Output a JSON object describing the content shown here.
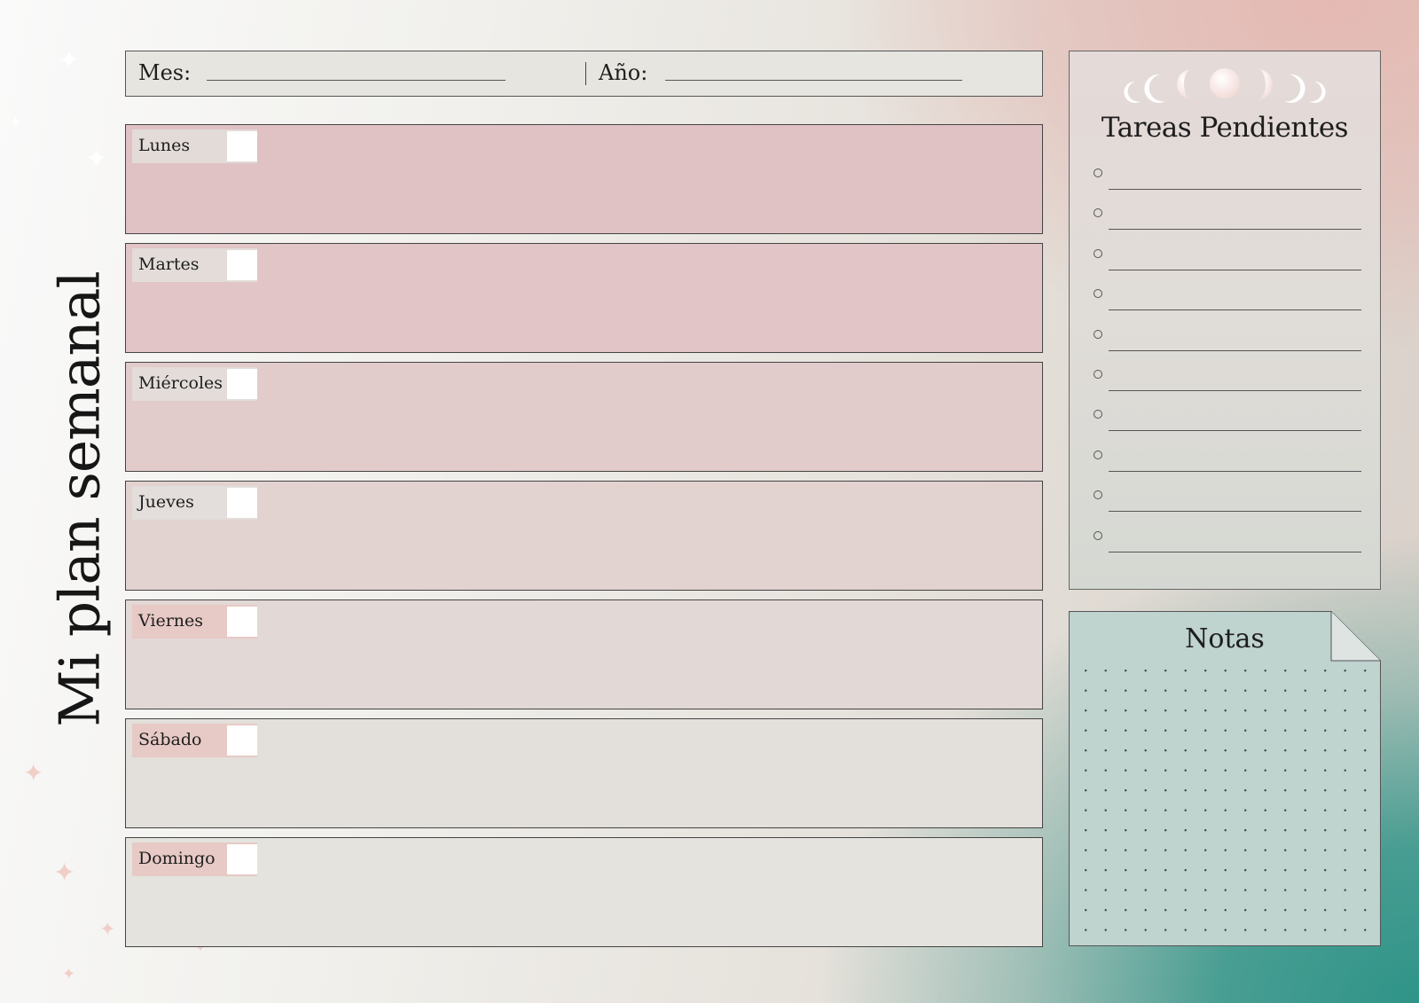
{
  "page": {
    "title": "Mi plan semanal"
  },
  "header": {
    "month_label": "Mes:",
    "year_label": "Año:"
  },
  "days": [
    {
      "label": "Lunes",
      "bg": "#e0c1c4",
      "tab": "#e3dbd8"
    },
    {
      "label": "Martes",
      "bg": "#e2c5c7",
      "tab": "#e3dcd9"
    },
    {
      "label": "Miércoles",
      "bg": "#e2cbcb",
      "tab": "#e3dcd9"
    },
    {
      "label": "Jueves",
      "bg": "#e2d2d0",
      "tab": "#e3dedb"
    },
    {
      "label": "Viernes",
      "bg": "#e2d8d6",
      "tab": "#e7c9c5"
    },
    {
      "label": "Sábado",
      "bg": "#e3dfdb",
      "tab": "#e7c9c5"
    },
    {
      "label": "Domingo",
      "bg": "#e4e3de",
      "tab": "#e7c9c5"
    }
  ],
  "tasks": {
    "title": "Tareas Pendientes",
    "count": 10
  },
  "notes": {
    "title": "Notas"
  },
  "colors": {
    "accent_teal": "#2f9488",
    "accent_pink": "#e5b9b3",
    "border": "#444444"
  }
}
